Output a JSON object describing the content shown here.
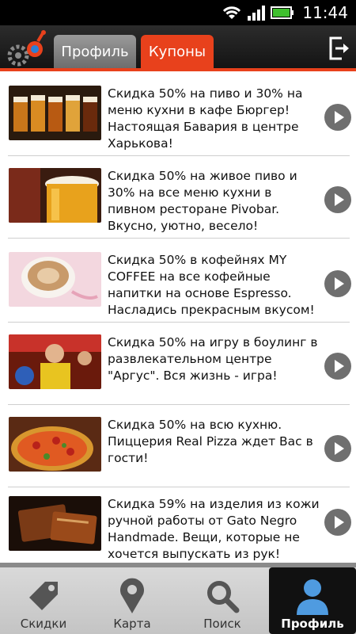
{
  "status_bar": {
    "time": "11:44"
  },
  "header": {
    "tabs": [
      {
        "label": "Профиль",
        "active": false
      },
      {
        "label": "Купоны",
        "active": true
      }
    ]
  },
  "coupons": [
    {
      "text": "Скидка 50% на пиво и 30% на меню кухни в кафе Бюргер! Настоящая Бавария в центре Харькова!",
      "image": "beer-mugs"
    },
    {
      "text": "Скидка 50% на живое пиво и 30% на все меню кухни в пивном ресторане Pivobar. Вкусно, уютно, весело!",
      "image": "beer-glass"
    },
    {
      "text": "Скидка 50% в кофейнях MY COFFEE на все кофейные напитки на основе Espresso. Насладись прекрасным вкусом!",
      "image": "coffee-cup"
    },
    {
      "text": "Скидка 50% на игру в боулинг в развлекательном центре \"Аргус\". Вся жизнь - игра!",
      "image": "bowling"
    },
    {
      "text": "Скидка 50% на всю кухню. Пиццерия Real Pizza ждет Вас в гости!",
      "image": "pizza"
    },
    {
      "text": "Скидка 59% на изделия из кожи ручной работы от Gato Negro Handmade. Вещи, которые не хочется выпускать из рук!",
      "image": "leather-goods"
    }
  ],
  "bottom_nav": [
    {
      "label": "Скидки",
      "icon": "tag-icon",
      "active": false
    },
    {
      "label": "Карта",
      "icon": "map-pin-icon",
      "active": false
    },
    {
      "label": "Поиск",
      "icon": "search-icon",
      "active": false
    },
    {
      "label": "Профиль",
      "icon": "user-icon",
      "active": true
    }
  ],
  "colors": {
    "accent": "#e8411c",
    "header": "#1c1c1c",
    "play_button": "#6f6f6f"
  }
}
